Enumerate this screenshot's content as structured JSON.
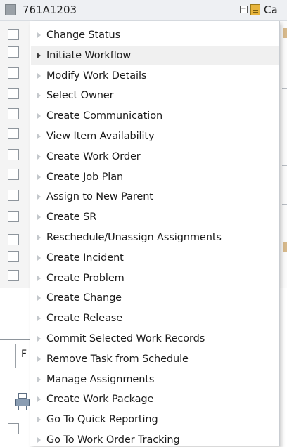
{
  "header": {
    "record_id": "761A1203",
    "truncated_label": "Ca"
  },
  "tab": {
    "truncated_label": "F"
  },
  "menu": {
    "active_index": 1,
    "items": [
      {
        "label": "Change Status"
      },
      {
        "label": "Initiate Workflow"
      },
      {
        "label": "Modify Work Details"
      },
      {
        "label": "Select Owner"
      },
      {
        "label": "Create Communication"
      },
      {
        "label": "View Item Availability"
      },
      {
        "label": "Create Work Order"
      },
      {
        "label": "Create Job Plan"
      },
      {
        "label": "Assign to New Parent"
      },
      {
        "label": "Create SR"
      },
      {
        "label": "Reschedule/Unassign Assignments"
      },
      {
        "label": "Create Incident"
      },
      {
        "label": "Create Problem"
      },
      {
        "label": "Create Change"
      },
      {
        "label": "Create Release"
      },
      {
        "label": "Commit Selected Work Records"
      },
      {
        "label": "Remove Task from Schedule"
      },
      {
        "label": "Manage Assignments"
      },
      {
        "label": "Create Work Package"
      },
      {
        "label": "Go To Quick Reporting"
      },
      {
        "label": "Go To Work Order Tracking"
      }
    ]
  },
  "icons": {
    "header_checkbox": "checkbox-icon",
    "collapse": "collapse-icon",
    "document": "document-icon",
    "printer": "printer-icon",
    "submenu_arrow": "chevron-right-icon"
  },
  "colors": {
    "menu_background": "#ffffff",
    "active_item_background": "#f0f0f0",
    "inactive_arrow": "#c4c8cc",
    "active_arrow": "#3a3a3a"
  }
}
